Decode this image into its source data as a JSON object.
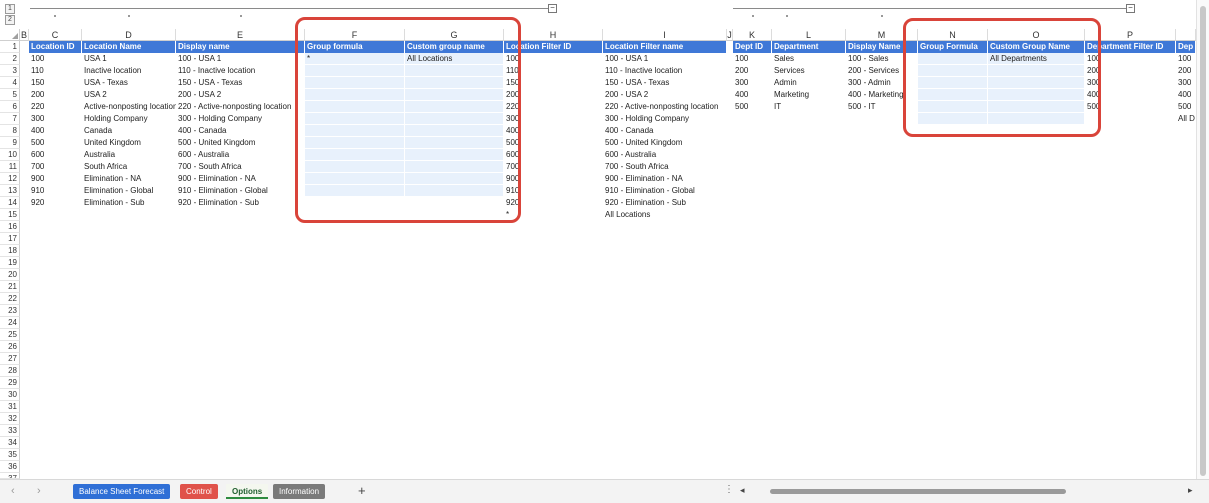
{
  "outline": {
    "levels": [
      "1",
      "2"
    ],
    "collapse_symbol": "−"
  },
  "columns": [
    "B",
    "C",
    "D",
    "E",
    "F",
    "G",
    "H",
    "I",
    "J",
    "K",
    "L",
    "M",
    "N",
    "O",
    "P",
    "Q"
  ],
  "rows": [
    "1",
    "2",
    "3",
    "4",
    "5",
    "6",
    "7",
    "8",
    "9",
    "10",
    "11",
    "12",
    "13",
    "14",
    "15",
    "16",
    "17",
    "18",
    "19",
    "20",
    "21",
    "22",
    "23",
    "24",
    "25",
    "26",
    "27",
    "28",
    "29",
    "30",
    "31",
    "32",
    "33",
    "34",
    "35",
    "36",
    "37"
  ],
  "headers": {
    "location_id": "Location ID",
    "location_name": "Location Name",
    "display_name": "Display name",
    "group_formula": "Group formula",
    "custom_group_name": "Custom group name",
    "location_filter_id": "Location Filter ID",
    "location_filter_name": "Location Filter name",
    "dept_id": "Dept ID",
    "department": "Department",
    "dept_display_name": "Display Name",
    "dept_group_formula": "Group Formula",
    "dept_custom_group_name": "Custom Group Name",
    "department_filter_id": "Department Filter ID",
    "dept_filter_name_partial": "Dep"
  },
  "locations": [
    {
      "id": "100",
      "name": "USA 1",
      "display": "100 - USA 1",
      "formula": "*",
      "group": "All Locations",
      "filter_id": "100",
      "filter_name": "100 - USA 1"
    },
    {
      "id": "110",
      "name": "Inactive location",
      "display": "110 - Inactive location",
      "formula": "",
      "group": "",
      "filter_id": "110",
      "filter_name": "110 - Inactive location"
    },
    {
      "id": "150",
      "name": "USA - Texas",
      "display": "150 - USA - Texas",
      "formula": "",
      "group": "",
      "filter_id": "150",
      "filter_name": "150 - USA - Texas"
    },
    {
      "id": "200",
      "name": "USA 2",
      "display": "200 - USA 2",
      "formula": "",
      "group": "",
      "filter_id": "200",
      "filter_name": "200 - USA 2"
    },
    {
      "id": "220",
      "name": "Active-nonposting location",
      "display": "220 - Active-nonposting location",
      "formula": "",
      "group": "",
      "filter_id": "220",
      "filter_name": "220 - Active-nonposting location"
    },
    {
      "id": "300",
      "name": "Holding Company",
      "display": "300 - Holding Company",
      "formula": "",
      "group": "",
      "filter_id": "300",
      "filter_name": "300 - Holding Company"
    },
    {
      "id": "400",
      "name": "Canada",
      "display": "400 - Canada",
      "formula": "",
      "group": "",
      "filter_id": "400",
      "filter_name": "400 - Canada"
    },
    {
      "id": "500",
      "name": "United Kingdom",
      "display": "500 - United Kingdom",
      "formula": "",
      "group": "",
      "filter_id": "500",
      "filter_name": "500 - United Kingdom"
    },
    {
      "id": "600",
      "name": "Australia",
      "display": "600 - Australia",
      "formula": "",
      "group": "",
      "filter_id": "600",
      "filter_name": "600 - Australia"
    },
    {
      "id": "700",
      "name": "South Africa",
      "display": "700 - South Africa",
      "formula": "",
      "group": "",
      "filter_id": "700",
      "filter_name": "700 - South Africa"
    },
    {
      "id": "900",
      "name": "Elimination - NA",
      "display": "900 - Elimination - NA",
      "formula": "",
      "group": "",
      "filter_id": "900",
      "filter_name": "900 - Elimination - NA"
    },
    {
      "id": "910",
      "name": "Elimination - Global",
      "display": "910 - Elimination - Global",
      "formula": "",
      "group": "",
      "filter_id": "910",
      "filter_name": "910 - Elimination - Global"
    },
    {
      "id": "920",
      "name": "Elimination - Sub",
      "display": "920 - Elimination - Sub",
      "formula": "",
      "group": "",
      "filter_id": "920",
      "filter_name": "920 - Elimination - Sub"
    },
    {
      "id": "",
      "name": "",
      "display": "",
      "formula": "",
      "group": "",
      "filter_id": "*",
      "filter_name": "All Locations"
    }
  ],
  "departments": [
    {
      "id": "100",
      "name": "Sales",
      "display": "100 - Sales",
      "formula": "",
      "group": "All Departments",
      "filter_id": "100",
      "filter_name": "100"
    },
    {
      "id": "200",
      "name": "Services",
      "display": "200 - Services",
      "formula": "",
      "group": "",
      "filter_id": "200",
      "filter_name": "200"
    },
    {
      "id": "300",
      "name": "Admin",
      "display": "300 - Admin",
      "formula": "",
      "group": "",
      "filter_id": "300",
      "filter_name": "300"
    },
    {
      "id": "400",
      "name": "Marketing",
      "display": "400 - Marketing",
      "formula": "",
      "group": "",
      "filter_id": "400",
      "filter_name": "400"
    },
    {
      "id": "500",
      "name": "IT",
      "display": "500 - IT",
      "formula": "",
      "group": "",
      "filter_id": "500",
      "filter_name": "500"
    },
    {
      "id": "",
      "name": "",
      "display": "",
      "formula": "",
      "group": "",
      "filter_id": "",
      "filter_name": "All D"
    }
  ],
  "tabs": [
    {
      "label": "Balance Sheet Forecast",
      "color": "#2f6fd6"
    },
    {
      "label": "Control",
      "color": "#e0524a"
    },
    {
      "label": "Options",
      "color": "#e8f0e0"
    },
    {
      "label": "Information",
      "color": "#7a7a7a"
    }
  ],
  "tab_nav": {
    "prev": "‹",
    "next": "›",
    "add": "+",
    "more": "⋮",
    "scroll_left": "◂",
    "scroll_right": "▸"
  },
  "colors": {
    "header_blue": "#3f78d7",
    "light_fill": "#e8f1fc",
    "highlight_red": "#d9443a"
  }
}
